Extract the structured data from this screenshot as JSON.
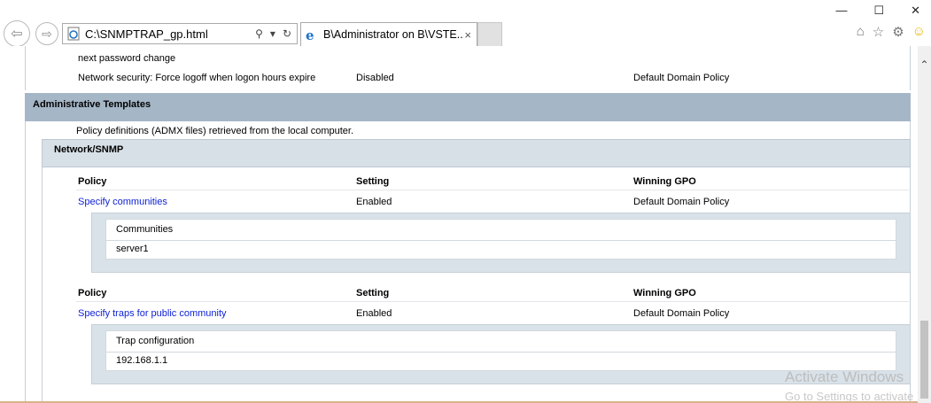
{
  "browser": {
    "address_url": "C:\\SNMPTRAP_gp.html",
    "tab_title": "B\\Administrator on B\\VSTE...",
    "tab_close": "×",
    "win_minimize": "—",
    "win_maximize": "☐",
    "win_close": "✕",
    "icons": [
      "back-icon",
      "forward-icon",
      "search-icon",
      "dropdown-icon",
      "refresh-icon",
      "ie-icon",
      "home-icon",
      "favorites-icon",
      "settings-icon",
      "smiley-icon"
    ]
  },
  "top_section": {
    "row_partial_policy": "next password change",
    "row_policy": "Network security: Force logoff when logon hours expire",
    "row_setting": "Disabled",
    "row_gpo": "Default Domain Policy"
  },
  "admin_templates": {
    "title": "Administrative Templates",
    "description": "Policy definitions (ADMX files) retrieved from the local computer."
  },
  "network_snmp": {
    "title": "Network/SNMP",
    "columns": {
      "policy": "Policy",
      "setting": "Setting",
      "gpo": "Winning GPO"
    },
    "policies": [
      {
        "name": "Specify communities",
        "setting": "Enabled",
        "gpo": "Default Domain Policy",
        "sub_header": "Communities",
        "sub_value": "server1"
      },
      {
        "name": "Specify traps for public community",
        "setting": "Enabled",
        "gpo": "Default Domain Policy",
        "sub_header": "Trap configuration",
        "sub_value": "192.168.1.1"
      }
    ]
  },
  "watermark": {
    "line1": "Activate Windows",
    "line2": "Go to Settings to activate"
  },
  "colors": {
    "admin_bar": "#a5b6c7",
    "section_bar": "#d7e0e7",
    "link": "#0c1fd6"
  }
}
